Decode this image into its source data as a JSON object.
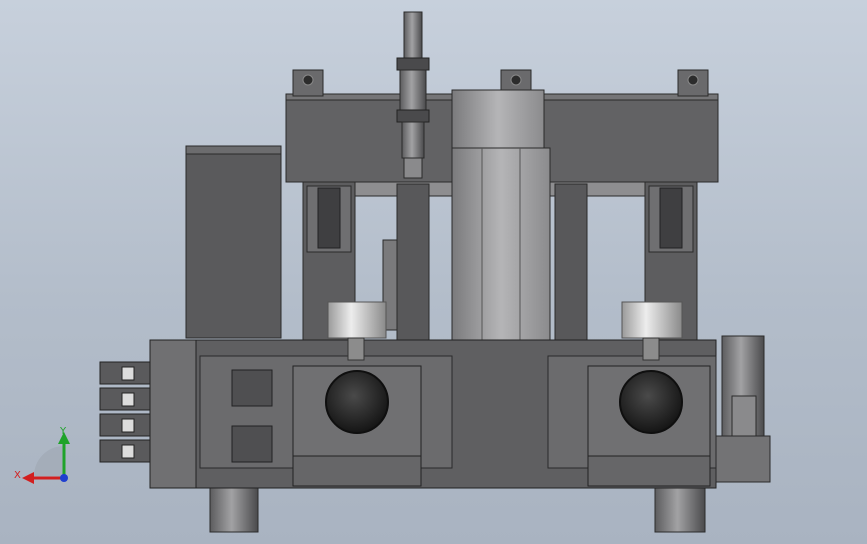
{
  "scene": {
    "type": "cad-model-front-view",
    "background_color": "#b9c2ce",
    "metal_dark": "#4a4a4c",
    "metal_mid": "#6e6e70",
    "metal_light": "#a9a9ab",
    "roller_color": "#cfcfcf"
  },
  "triad": {
    "x_label": "X",
    "y_label": "Y",
    "x_color": "#d21f1f",
    "y_color": "#1fa32a",
    "z_color": "#1f3fcf"
  },
  "connectors": [
    "connector-1",
    "connector-2",
    "connector-3",
    "connector-4"
  ]
}
